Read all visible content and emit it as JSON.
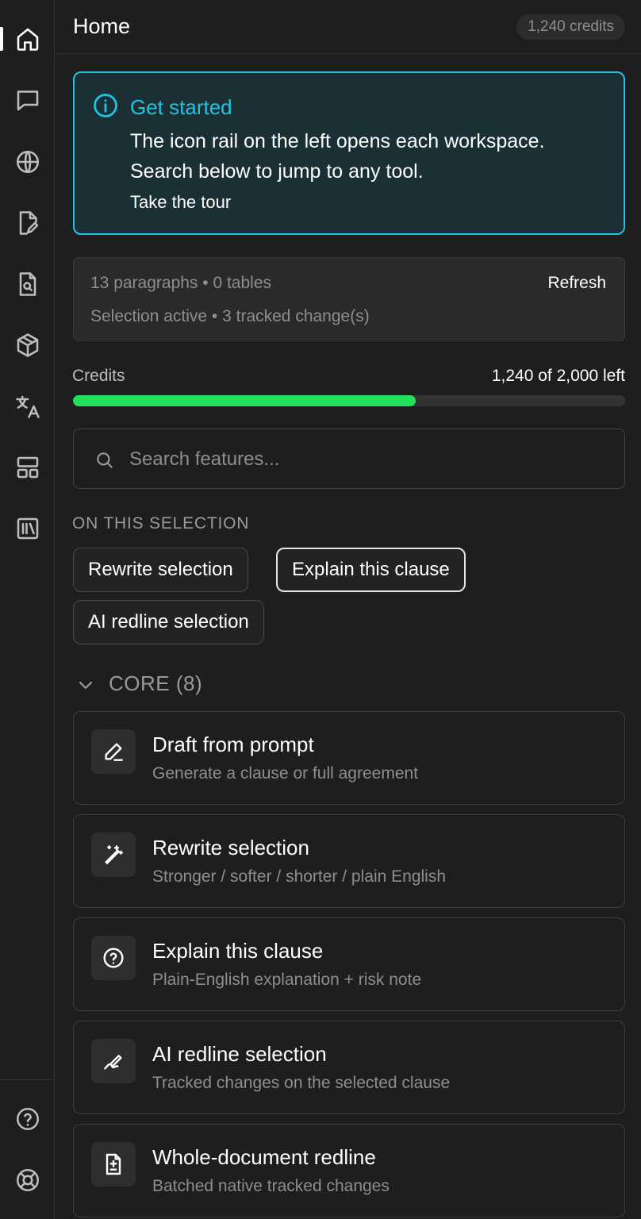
{
  "header": {
    "title": "Home",
    "credits_badge": "1,240 credits"
  },
  "rail": {
    "items": [
      {
        "icon": "home-icon",
        "active": true
      },
      {
        "icon": "chat-icon"
      },
      {
        "icon": "globe-icon"
      },
      {
        "icon": "document-edit-icon"
      },
      {
        "icon": "document-search-icon"
      },
      {
        "icon": "box-icon"
      },
      {
        "icon": "translate-icon"
      },
      {
        "icon": "layout-icon"
      },
      {
        "icon": "library-icon"
      }
    ],
    "bottom_items": [
      {
        "icon": "help-icon"
      },
      {
        "icon": "lifebuoy-icon"
      }
    ]
  },
  "banner": {
    "icon": "info-icon",
    "title": "Get started",
    "line1": "The icon rail on the left opens each workspace.",
    "line2": "Search below to jump to any tool.",
    "link": "Take the tour",
    "accent": "#22c3e0"
  },
  "stats": {
    "line1": "13 paragraphs • 0 tables",
    "line2": "Selection active • 3 tracked change(s)",
    "refresh": "Refresh"
  },
  "credits": {
    "label": "Credits",
    "remaining_text": "1,240 of 2,000 left",
    "fraction": 0.62,
    "color": "#22e05a"
  },
  "search": {
    "placeholder": "Search features..."
  },
  "selection_section": {
    "label": "ON THIS SELECTION",
    "chips": [
      "Rewrite selection",
      "Explain this clause",
      "AI redline selection"
    ]
  },
  "core_group": {
    "label": "CORE (8)",
    "expanded": true,
    "cards": [
      {
        "icon": "pencil-icon",
        "title": "Draft from prompt",
        "desc": "Generate a clause or full agreement"
      },
      {
        "icon": "magic-wand-icon",
        "title": "Rewrite selection",
        "desc": "Stronger / softer / shorter / plain English"
      },
      {
        "icon": "question-circle-icon",
        "title": "Explain this clause",
        "desc": "Plain-English explanation + risk note"
      },
      {
        "icon": "signature-icon",
        "title": "AI redline selection",
        "desc": "Tracked changes on the selected clause"
      },
      {
        "icon": "document-diff-icon",
        "title": "Whole-document redline",
        "desc": "Batched native tracked changes"
      }
    ]
  }
}
